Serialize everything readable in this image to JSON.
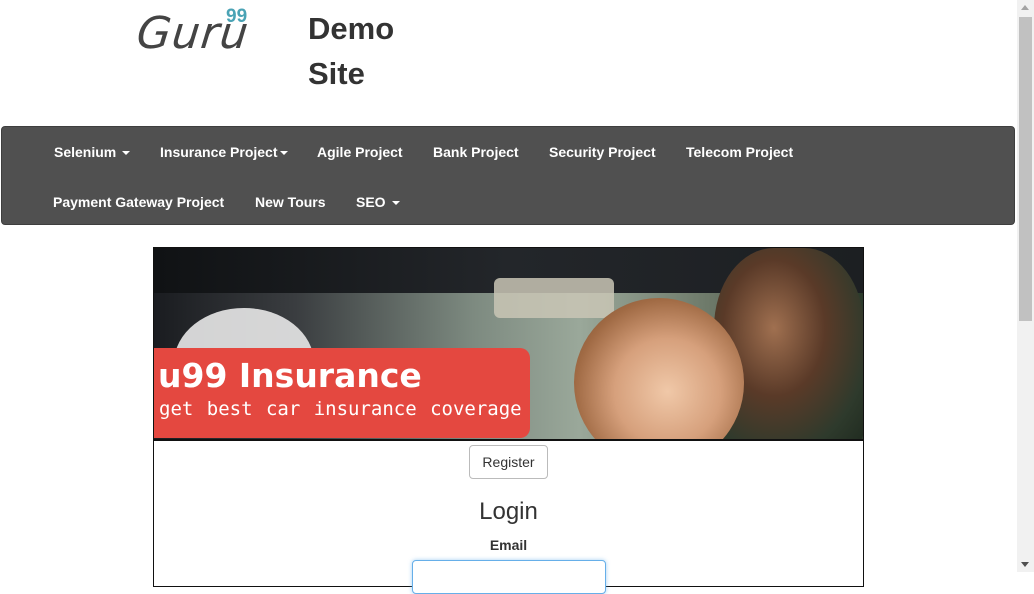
{
  "header": {
    "logo_text": "Guru",
    "logo_sup": "99",
    "site_title_line1": "Demo",
    "site_title_line2": "Site"
  },
  "navbar": {
    "items": [
      {
        "label": "Selenium",
        "dropdown": true
      },
      {
        "label": "Insurance Project",
        "dropdown": true
      },
      {
        "label": "Agile Project",
        "dropdown": false
      },
      {
        "label": "Bank Project",
        "dropdown": false
      },
      {
        "label": "Security Project",
        "dropdown": false
      },
      {
        "label": "Telecom Project",
        "dropdown": false
      },
      {
        "label": "Payment Gateway Project",
        "dropdown": false
      },
      {
        "label": "New Tours",
        "dropdown": false
      },
      {
        "label": "SEO",
        "dropdown": true
      }
    ],
    "background_color": "#505050"
  },
  "banner": {
    "title": "u99 Insurance",
    "subtitle": "get best car insurance coverage",
    "accent_color": "#e44840"
  },
  "main": {
    "register_button_label": "Register",
    "login_heading": "Login",
    "email_label": "Email",
    "email_value": ""
  }
}
